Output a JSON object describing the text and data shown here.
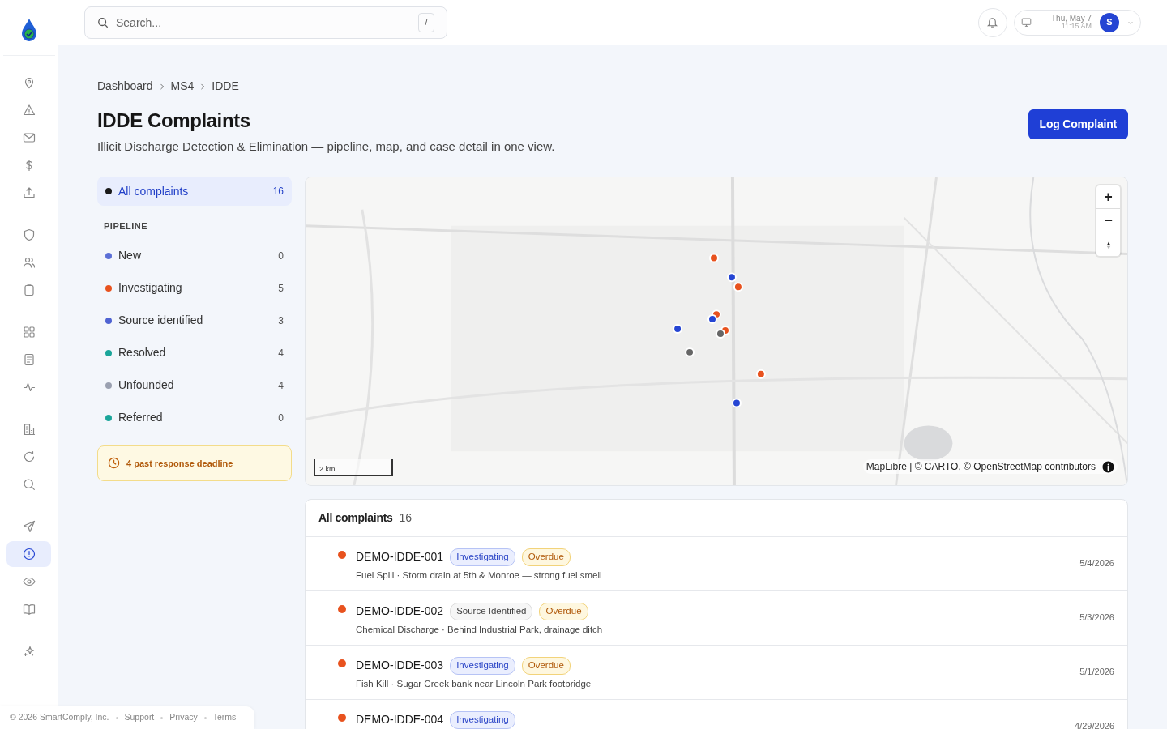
{
  "nav_groups": [
    {
      "items": [
        {
          "selected": false
        },
        {
          "selected": false
        },
        {
          "selected": false
        },
        {
          "selected": false
        },
        {
          "selected": false
        }
      ]
    },
    {
      "items": [
        {
          "selected": false
        },
        {
          "selected": false
        },
        {
          "selected": false
        }
      ]
    },
    {
      "items": [
        {
          "selected": false
        },
        {
          "selected": false
        },
        {
          "selected": false
        }
      ]
    },
    {
      "items": [
        {
          "selected": false
        },
        {
          "selected": false
        },
        {
          "selected": false
        }
      ]
    },
    {
      "items": [
        {
          "selected": false
        },
        {
          "selected": true
        },
        {
          "selected": false
        },
        {
          "selected": false
        }
      ]
    },
    {
      "items": [
        {
          "selected": false
        }
      ]
    }
  ],
  "search": {
    "placeholder": "Search...",
    "shortcut": "/"
  },
  "topbar": {
    "date": "Thu, May 7",
    "time": "11:15 AM",
    "avatar": "S"
  },
  "breadcrumb": [
    "Dashboard",
    "MS4",
    "IDDE"
  ],
  "title": "IDDE Complaints",
  "subtitle": "Illicit Discharge Detection & Elimination — pipeline, map, and case detail in one view.",
  "primary_button": "Log Complaint",
  "filters": {
    "all": {
      "label": "All complaints",
      "count": "16",
      "selected": true,
      "color": "#1a1a1a"
    },
    "section": "PIPELINE",
    "items": [
      {
        "label": "New",
        "count": "0",
        "selected": false,
        "color": "#5b6fd6"
      },
      {
        "label": "Investigating",
        "count": "5",
        "selected": false,
        "color": "#e8521e"
      },
      {
        "label": "Source identified",
        "count": "3",
        "selected": false,
        "color": "#4f63d2"
      },
      {
        "label": "Resolved",
        "count": "4",
        "selected": false,
        "color": "#1aa59a"
      },
      {
        "label": "Unfounded",
        "count": "4",
        "selected": false,
        "color": "#9aa0b0"
      },
      {
        "label": "Referred",
        "count": "0",
        "selected": false,
        "color": "#1aa59a"
      }
    ]
  },
  "alert": "4 past response deadline",
  "map": {
    "zoom_in": "+",
    "zoom_out": "−",
    "scale": "2 km",
    "attribution": "MapLibre | © CARTO, © OpenStreetMap contributors"
  },
  "list": {
    "title": "All complaints",
    "count": "16",
    "rows": [
      {
        "id": "DEMO-IDDE-001",
        "color": "#e8521e",
        "badges": [
          {
            "text": "Investigating",
            "kind": "investigating"
          },
          {
            "text": "Overdue",
            "kind": "overdue"
          }
        ],
        "detail": "Fuel Spill · Storm drain at 5th & Monroe — strong fuel smell",
        "date": "5/4/2026"
      },
      {
        "id": "DEMO-IDDE-002",
        "color": "#e8521e",
        "badges": [
          {
            "text": "Source Identified",
            "kind": "neutral"
          },
          {
            "text": "Overdue",
            "kind": "overdue"
          }
        ],
        "detail": "Chemical Discharge · Behind Industrial Park, drainage ditch",
        "date": "5/3/2026"
      },
      {
        "id": "DEMO-IDDE-003",
        "color": "#e8521e",
        "badges": [
          {
            "text": "Investigating",
            "kind": "investigating"
          },
          {
            "text": "Overdue",
            "kind": "overdue"
          }
        ],
        "detail": "Fish Kill · Sugar Creek bank near Lincoln Park footbridge",
        "date": "5/1/2026"
      },
      {
        "id": "DEMO-IDDE-004",
        "color": "#e8521e",
        "badges": [
          {
            "text": "Investigating",
            "kind": "investigating"
          }
        ],
        "date": "4/29/2026"
      }
    ]
  },
  "footer": {
    "copyright": "© 2026 SmartComply, Inc.",
    "links": [
      "Support",
      "Privacy",
      "Terms"
    ]
  }
}
